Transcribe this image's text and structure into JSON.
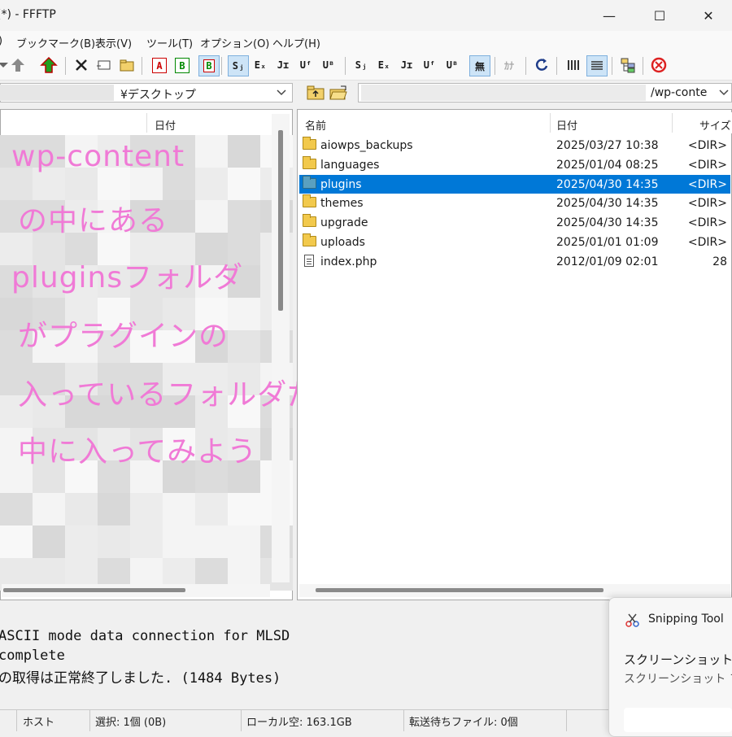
{
  "window": {
    "title": "(*) - FFFTP",
    "min_icon": "minimize-icon",
    "max_icon": "maximize-icon",
    "close_icon": "close-icon"
  },
  "menu": [
    ")",
    "ブックマーク(B)",
    "表示(V)",
    "ツール(T)",
    "オプション(O)",
    "ヘルプ(H)"
  ],
  "toolbar": {
    "text_buttons": {
      "ascii": "A",
      "binary": "B",
      "auto": "B",
      "sjis1": "Sⱼ",
      "euc1": "Eₓ",
      "jis1": "Jɪ",
      "utf1": "Uᶠ",
      "utf1b": "Uᴮ",
      "sjis2": "Sⱼ",
      "euc2": "Eₓ",
      "jis2": "Jɪ",
      "utf2": "Uᶠ",
      "utf2b": "Uᴮ",
      "none": "無",
      "kana": "ｶﾅ"
    }
  },
  "local": {
    "path": "¥デスクトップ",
    "columns": {
      "date": "日付"
    }
  },
  "remote": {
    "path": "/wp-conte",
    "columns": {
      "name": "名前",
      "date": "日付",
      "size": "サイズ"
    },
    "rows": [
      {
        "name": "aiowps_backups",
        "date": "2025/03/27 10:38",
        "size": "<DIR>",
        "type": "folder"
      },
      {
        "name": "languages",
        "date": "2025/01/04 08:25",
        "size": "<DIR>",
        "type": "folder"
      },
      {
        "name": "plugins",
        "date": "2025/04/30 14:35",
        "size": "<DIR>",
        "type": "folder",
        "selected": true
      },
      {
        "name": "themes",
        "date": "2025/04/30 14:35",
        "size": "<DIR>",
        "type": "folder"
      },
      {
        "name": "upgrade",
        "date": "2025/04/30 14:35",
        "size": "<DIR>",
        "type": "folder"
      },
      {
        "name": "uploads",
        "date": "2025/01/01 01:09",
        "size": "<DIR>",
        "type": "folder"
      },
      {
        "name": "index.php",
        "date": "2012/01/09 02:01",
        "size": "28",
        "type": "file"
      }
    ]
  },
  "annotation": [
    "wp-content",
    "の中にある",
    "pluginsフォルダ",
    "がプラグインの",
    "入っているフォルダだよ",
    "中に入ってみよう"
  ],
  "log": [
    "ASCII mode data connection for MLSD",
    "complete",
    "の取得は正常終了しました. (1484 Bytes)"
  ],
  "status": {
    "host": "ホスト",
    "selection": "選択: 1個 (0B)",
    "local_free": "ローカル空: 163.1GB",
    "queue": "転送待ちファイル: 0個"
  },
  "snipping": {
    "app": "Snipping Tool",
    "line1": "スクリーンショットをク",
    "line2": "スクリーンショット フォ"
  },
  "colors": {
    "selection": "#0078d7",
    "annotation": "#f07ad6",
    "folder": "#f2c94c"
  }
}
